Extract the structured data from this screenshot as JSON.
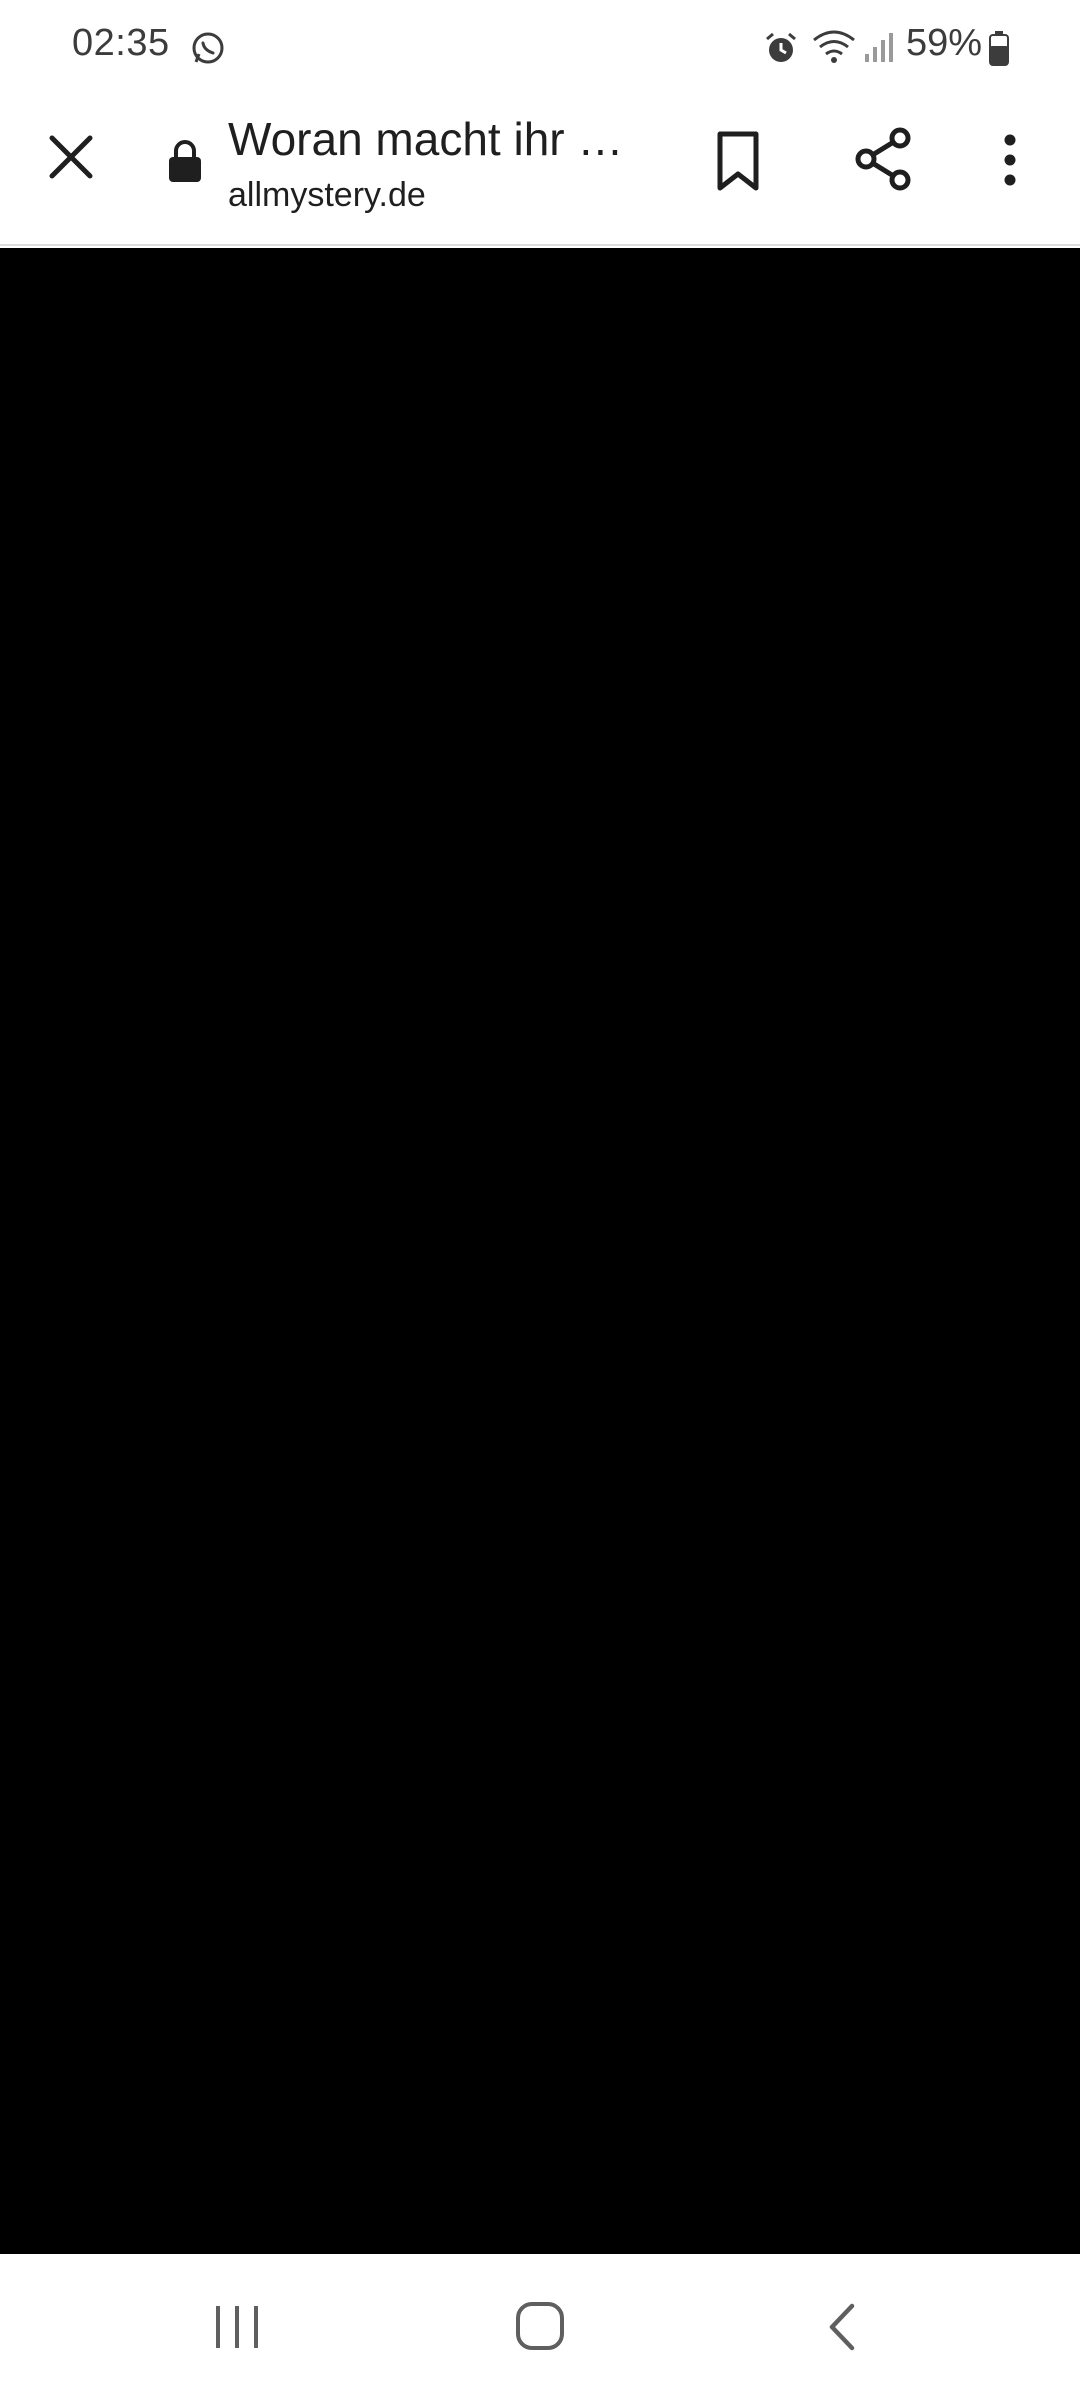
{
  "status_bar": {
    "time": "02:35",
    "battery_percent": "59%"
  },
  "toolbar": {
    "title": "Woran macht ihr …",
    "domain": "allmystery.de"
  },
  "icons": {
    "notification": "whatsapp-icon",
    "alarm": "alarm-icon",
    "wifi": "wifi-icon",
    "signal": "signal-icon",
    "battery": "battery-icon",
    "close": "close-icon",
    "lock": "lock-icon",
    "bookmark": "bookmark-icon",
    "share": "share-icon",
    "menu": "more-vert-icon",
    "recents": "recents-icon",
    "home": "home-icon",
    "back": "back-icon"
  },
  "colors": {
    "content_background": "#000000",
    "chrome_background": "#ffffff",
    "icon": "#1f1f1f"
  }
}
